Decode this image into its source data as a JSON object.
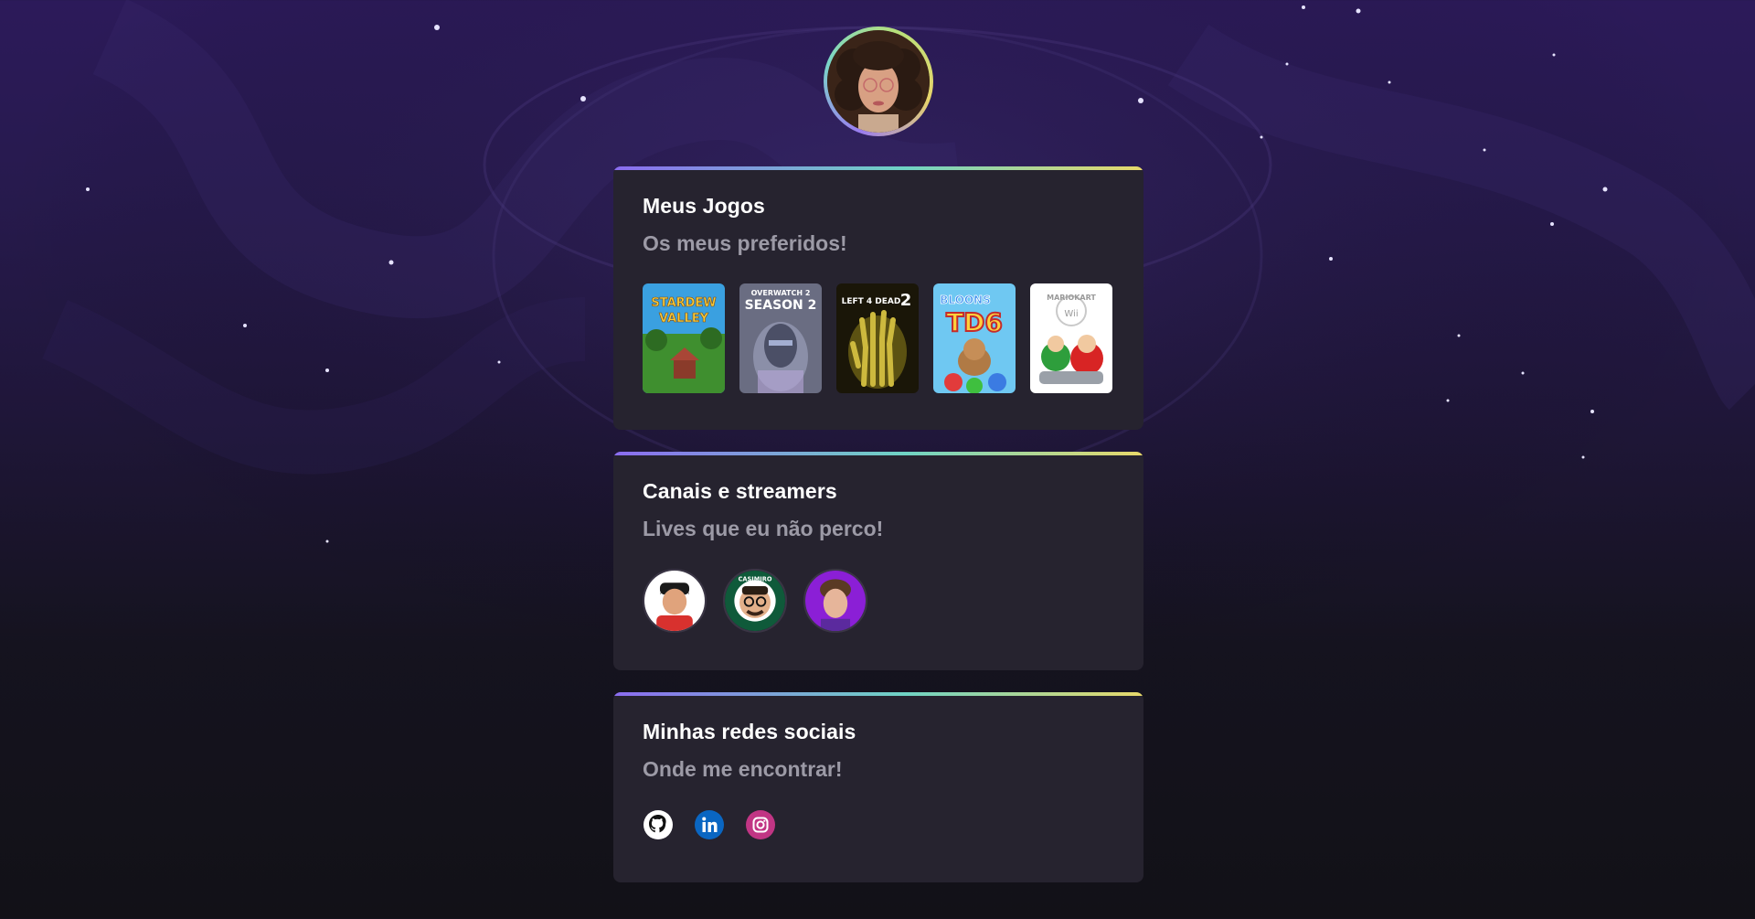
{
  "profile": {
    "avatar_icon": "profile-avatar",
    "ring_colors": [
      "#9a7cf0",
      "#7ad6c8",
      "#e8d46b"
    ]
  },
  "games_card": {
    "title": "Meus Jogos",
    "subtitle": "Os meus preferidos!",
    "items": [
      {
        "name": "Stardew Valley",
        "cover_text_1": "STARDEW",
        "cover_text_2": "VALLEY"
      },
      {
        "name": "Overwatch 2 Season 2",
        "cover_text_1": "OVERWATCH 2",
        "cover_text_2": "SEASON 2"
      },
      {
        "name": "Left 4 Dead 2",
        "cover_text_1": "LEFT 4 DEAD",
        "cover_text_2": "2"
      },
      {
        "name": "Bloons TD 6",
        "cover_text_1": "BLOONS",
        "cover_text_2": "TD6"
      },
      {
        "name": "Mario Kart Wii",
        "cover_text_1": "MARIOKART",
        "cover_text_2": "Wii"
      }
    ]
  },
  "streamers_card": {
    "title": "Canais e streamers",
    "subtitle": "Lives que eu não perco!",
    "items": [
      {
        "icon": "streamer-1-avatar"
      },
      {
        "icon": "casimiro-avatar",
        "badge_text": "CASIMIRO"
      },
      {
        "icon": "streamer-3-avatar"
      }
    ]
  },
  "socials_card": {
    "title": "Minhas redes sociais",
    "subtitle": "Onde me encontrar!",
    "items": [
      {
        "icon": "github-icon",
        "color": "#ffffff"
      },
      {
        "icon": "linkedin-icon",
        "color": "#0a66c2"
      },
      {
        "icon": "instagram-icon",
        "color": "#c13584"
      }
    ]
  },
  "colors": {
    "card_bg": "#26232f",
    "accent_gradient": [
      "#8b6cf0",
      "#6fd3c4",
      "#e8d96a"
    ],
    "title": "#ffffff",
    "subtitle": "#9c9aa6"
  }
}
